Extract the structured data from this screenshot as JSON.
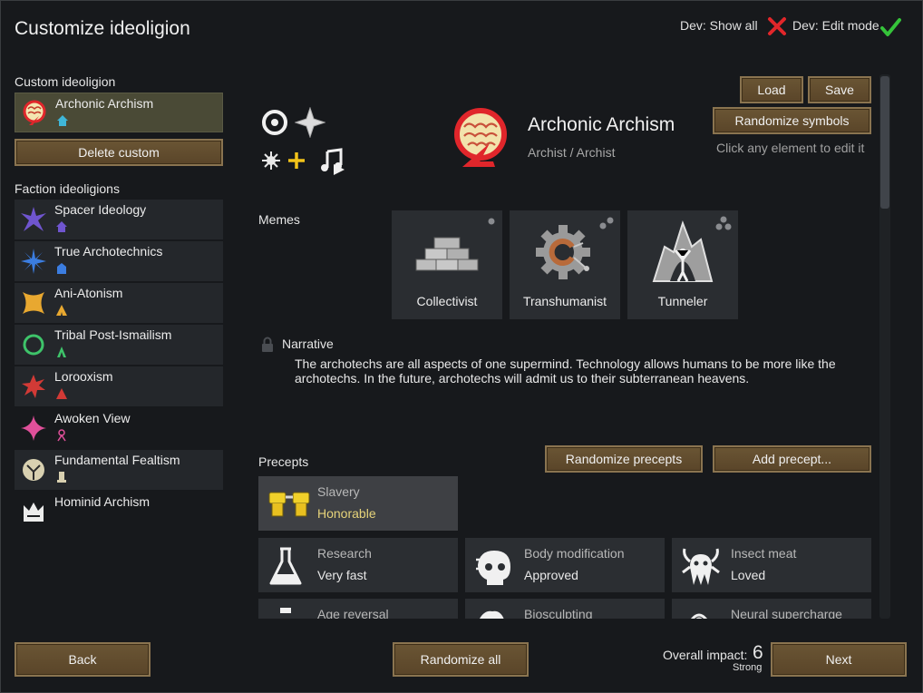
{
  "header": {
    "title": "Customize ideoligion",
    "dev_show_all": "Dev: Show all",
    "dev_edit_mode": "Dev: Edit mode"
  },
  "left": {
    "custom_heading": "Custom ideoligion",
    "custom_item": {
      "name": "Archonic Archism",
      "icon": "archonic-symbol",
      "color": "#e0262b"
    },
    "delete_label": "Delete custom",
    "faction_heading": "Faction ideoligions",
    "factions": [
      {
        "name": "Spacer Ideology",
        "icon": "star-icon",
        "color": "#7a5fd8"
      },
      {
        "name": "True Archotechnics",
        "icon": "burst-icon",
        "color": "#3b7de0"
      },
      {
        "name": "Ani-Atonism",
        "icon": "diamond-icon",
        "color": "#e8a830"
      },
      {
        "name": "Tribal Post-Ismailism",
        "icon": "ring-icon",
        "color": "#3ec46a"
      },
      {
        "name": "Lorooxism",
        "icon": "splat-icon",
        "color": "#d23a36"
      },
      {
        "name": "Awoken View",
        "icon": "star4-icon",
        "color": "#e0509a"
      },
      {
        "name": "Fundamental Fealtism",
        "icon": "shield-icon",
        "color": "#d8d0b0"
      },
      {
        "name": "Hominid Archism",
        "icon": "crown-icon",
        "color": "#e8e8e8"
      }
    ]
  },
  "main": {
    "ideo_name": "Archonic Archism",
    "culture": "Archist / Archist",
    "load": "Load",
    "save": "Save",
    "randomize_symbols": "Randomize symbols",
    "hint": "Click any element to edit it",
    "memes_heading": "Memes",
    "memes": [
      {
        "name": "Collectivist",
        "icon": "brick-wall-icon",
        "impact": 1
      },
      {
        "name": "Transhumanist",
        "icon": "gear-icon",
        "impact": 2
      },
      {
        "name": "Tunneler",
        "icon": "cave-icon",
        "impact": 3
      }
    ],
    "narrative_heading": "Narrative",
    "narrative": "The archotechs are all aspects of one supermind. Technology allows humans to be more like the archotechs. In the future, archotechs will admit us to their subterranean heavens.",
    "precepts_heading": "Precepts",
    "randomize_precepts": "Randomize precepts",
    "add_precept": "Add precept...",
    "precepts": [
      {
        "name": "Slavery",
        "value": "Honorable",
        "icon": "shackles-icon"
      },
      {
        "name": "Research",
        "value": "Very fast",
        "icon": "flask-icon"
      },
      {
        "name": "Body modification",
        "value": "Approved",
        "icon": "cyborg-head-icon"
      },
      {
        "name": "Insect meat",
        "value": "Loved",
        "icon": "insect-icon"
      },
      {
        "name": "Age reversal",
        "value": "",
        "icon": "age-icon"
      },
      {
        "name": "Biosculpting",
        "value": "",
        "icon": "biosculpt-icon"
      },
      {
        "name": "Neural supercharge",
        "value": "",
        "icon": "neural-icon"
      }
    ]
  },
  "footer": {
    "back": "Back",
    "randomize_all": "Randomize all",
    "impact_label": "Overall impact:",
    "impact_value": "6",
    "impact_word": "Strong",
    "next": "Next"
  }
}
